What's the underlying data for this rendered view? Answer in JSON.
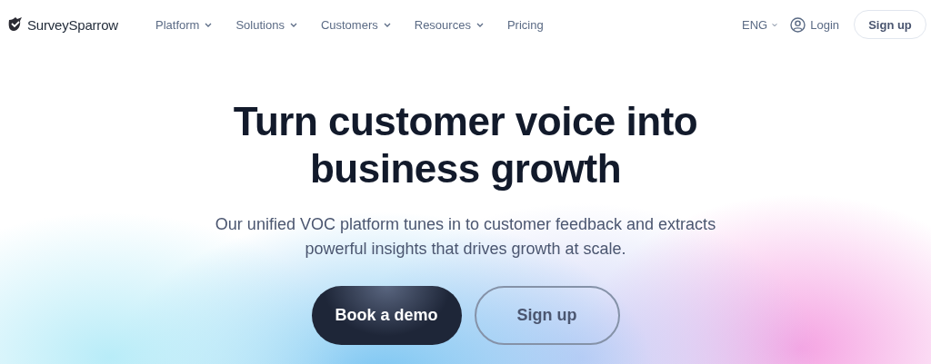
{
  "header": {
    "logo": "SurveySparrow",
    "nav": [
      {
        "label": "Platform",
        "has_menu": true
      },
      {
        "label": "Solutions",
        "has_menu": true
      },
      {
        "label": "Customers",
        "has_menu": true
      },
      {
        "label": "Resources",
        "has_menu": true
      },
      {
        "label": "Pricing",
        "has_menu": false
      }
    ],
    "language": "ENG",
    "login": "Login",
    "signup": "Sign up"
  },
  "hero": {
    "title_lines": [
      "Turn customer voice into",
      "business growth"
    ],
    "subtitle_lines": [
      "Our unified VOC platform tunes in to customer feedback and extracts",
      "powerful insights that drives growth at scale."
    ],
    "buttons": [
      {
        "label": "Book a demo",
        "kind": "primary"
      },
      {
        "label": "Sign up",
        "kind": "outline"
      }
    ]
  }
}
